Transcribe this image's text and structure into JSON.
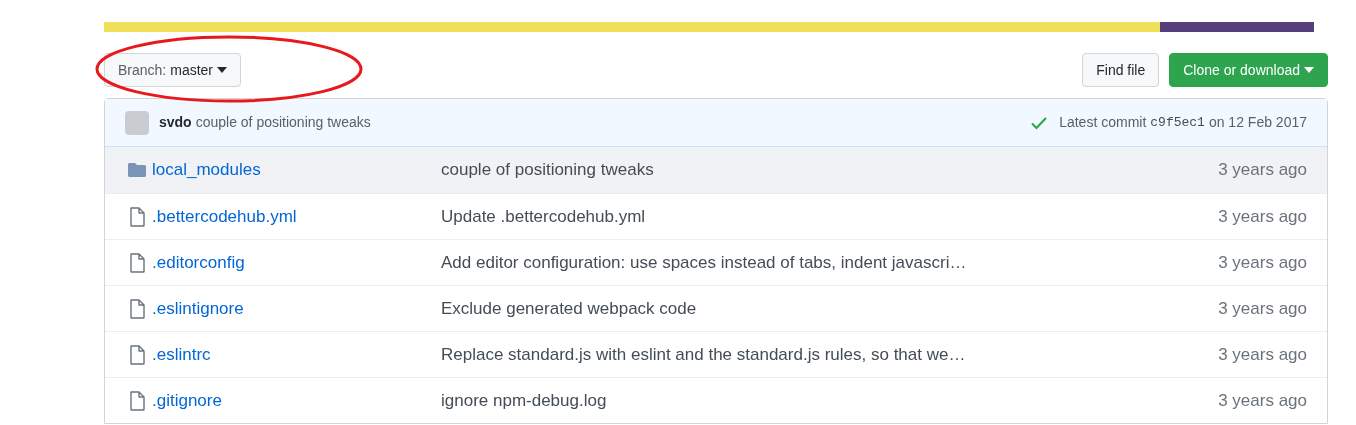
{
  "language_bar": {
    "level": 0.873
  },
  "branch_button": {
    "label": "Branch:",
    "value": "master"
  },
  "find_file_button": "Find file",
  "clone_button": "Clone or download",
  "commit_header": {
    "author": "svdo",
    "message": "couple of positioning tweaks",
    "latest_label": "Latest commit",
    "hash": "c9f5ec1",
    "date": "on 12 Feb 2017"
  },
  "files": [
    {
      "kind": "folder",
      "name": "local_modules",
      "message": "couple of positioning tweaks",
      "age": "3 years ago",
      "hovered": true
    },
    {
      "kind": "file",
      "name": ".bettercodehub.yml",
      "message": "Update .bettercodehub.yml",
      "age": "3 years ago",
      "hovered": false
    },
    {
      "kind": "file",
      "name": ".editorconfig",
      "message": "Add editor configuration: use spaces instead of tabs, indent javascri…",
      "age": "3 years ago",
      "hovered": false
    },
    {
      "kind": "file",
      "name": ".eslintignore",
      "message": "Exclude generated webpack code",
      "age": "3 years ago",
      "hovered": false
    },
    {
      "kind": "file",
      "name": ".eslintrc",
      "message": "Replace standard.js with eslint and the standard.js rules, so that we…",
      "age": "3 years ago",
      "hovered": false
    },
    {
      "kind": "file",
      "name": ".gitignore",
      "message": "ignore npm-debug.log",
      "age": "3 years ago",
      "hovered": false
    }
  ]
}
